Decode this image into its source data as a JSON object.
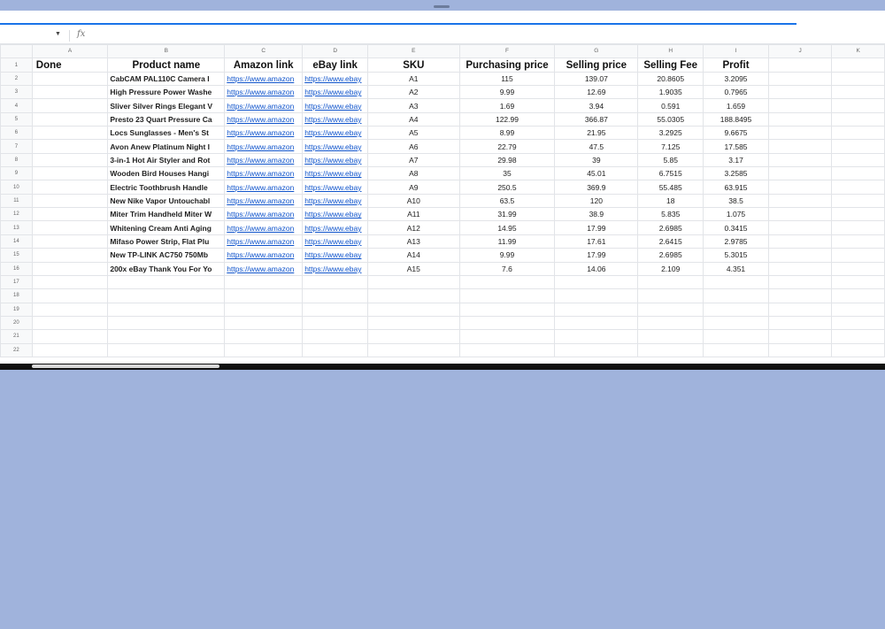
{
  "formula_bar": {
    "fx_label": "fx"
  },
  "columns": [
    "A",
    "B",
    "C",
    "D",
    "E",
    "F",
    "G",
    "H",
    "I",
    "J",
    "K"
  ],
  "headers": {
    "done": "Done",
    "product_name": "Product name",
    "amazon_link": "Amazon link",
    "ebay_link": "eBay link",
    "sku": "SKU",
    "purchasing_price": "Purchasing price",
    "selling_price": "Selling price",
    "selling_fee": "Selling Fee",
    "profit": "Profit"
  },
  "rows": [
    {
      "product": "CabCAM PAL110C Camera I",
      "amazon": "https://www.amazon",
      "ebay": "https://www.ebay",
      "sku": "A1",
      "purchasing_price": "115",
      "selling_price": "139.07",
      "selling_fee": "20.8605",
      "profit": "3.2095"
    },
    {
      "product": "High Pressure Power Washe",
      "amazon": "https://www.amazon",
      "ebay": "https://www.ebay",
      "sku": "A2",
      "purchasing_price": "9.99",
      "selling_price": "12.69",
      "selling_fee": "1.9035",
      "profit": "0.7965"
    },
    {
      "product": "Sliver Silver Rings Elegant V",
      "amazon": "https://www.amazon",
      "ebay": "https://www.ebay",
      "sku": "A3",
      "purchasing_price": "1.69",
      "selling_price": "3.94",
      "selling_fee": "0.591",
      "profit": "1.659"
    },
    {
      "product": "Presto 23 Quart Pressure Ca",
      "amazon": "https://www.amazon",
      "ebay": "https://www.ebay",
      "sku": "A4",
      "purchasing_price": "122.99",
      "selling_price": "366.87",
      "selling_fee": "55.0305",
      "profit": "188.8495"
    },
    {
      "product": "Locs Sunglasses - Men's St",
      "amazon": "https://www.amazon",
      "ebay": "https://www.ebay",
      "sku": "A5",
      "purchasing_price": "8.99",
      "selling_price": "21.95",
      "selling_fee": "3.2925",
      "profit": "9.6675"
    },
    {
      "product": "Avon Anew Platinum Night I",
      "amazon": "https://www.amazon",
      "ebay": "https://www.ebay",
      "sku": "A6",
      "purchasing_price": "22.79",
      "selling_price": "47.5",
      "selling_fee": "7.125",
      "profit": "17.585"
    },
    {
      "product": "3-in-1 Hot Air Styler and Rot",
      "amazon": "https://www.amazon",
      "ebay": "https://www.ebay",
      "sku": "A7",
      "purchasing_price": "29.98",
      "selling_price": "39",
      "selling_fee": "5.85",
      "profit": "3.17"
    },
    {
      "product": "Wooden Bird Houses Hangi",
      "amazon": "https://www.amazon",
      "ebay": "https://www.ebay",
      "sku": "A8",
      "purchasing_price": "35",
      "selling_price": "45.01",
      "selling_fee": "6.7515",
      "profit": "3.2585"
    },
    {
      "product": "Electric Toothbrush Handle",
      "amazon": "https://www.amazon",
      "ebay": "https://www.ebay",
      "sku": "A9",
      "purchasing_price": "250.5",
      "selling_price": "369.9",
      "selling_fee": "55.485",
      "profit": "63.915"
    },
    {
      "product": "New Nike Vapor Untouchabl",
      "amazon": "https://www.amazon",
      "ebay": "https://www.ebay",
      "sku": "A10",
      "purchasing_price": "63.5",
      "selling_price": "120",
      "selling_fee": "18",
      "profit": "38.5"
    },
    {
      "product": "Miter Trim Handheld Miter W",
      "amazon": "https://www.amazon",
      "ebay": "https://www.ebay",
      "sku": "A11",
      "purchasing_price": "31.99",
      "selling_price": "38.9",
      "selling_fee": "5.835",
      "profit": "1.075"
    },
    {
      "product": "Whitening Cream Anti Aging",
      "amazon": "https://www.amazon",
      "ebay": "https://www.ebay",
      "sku": "A12",
      "purchasing_price": "14.95",
      "selling_price": "17.99",
      "selling_fee": "2.6985",
      "profit": "0.3415"
    },
    {
      "product": "Mifaso Power Strip, Flat Plu",
      "amazon": "https://www.amazon",
      "ebay": "https://www.ebay",
      "sku": "A13",
      "purchasing_price": "11.99",
      "selling_price": "17.61",
      "selling_fee": "2.6415",
      "profit": "2.9785"
    },
    {
      "product": "New TP-LINK AC750 750Mb",
      "amazon": "https://www.amazon",
      "ebay": "https://www.ebay",
      "sku": "A14",
      "purchasing_price": "9.99",
      "selling_price": "17.99",
      "selling_fee": "2.6985",
      "profit": "5.3015"
    },
    {
      "product": "200x eBay Thank You For Yo",
      "amazon": "https://www.amazon",
      "ebay": "https://www.ebay",
      "sku": "A15",
      "purchasing_price": "7.6",
      "selling_price": "14.06",
      "selling_fee": "2.109",
      "profit": "4.351"
    }
  ],
  "row_numbers": [
    "1",
    "2",
    "3",
    "4",
    "5",
    "6",
    "7",
    "8",
    "9",
    "10",
    "11",
    "12",
    "13",
    "14",
    "15",
    "16",
    "17",
    "18",
    "19",
    "20",
    "21",
    "22"
  ]
}
